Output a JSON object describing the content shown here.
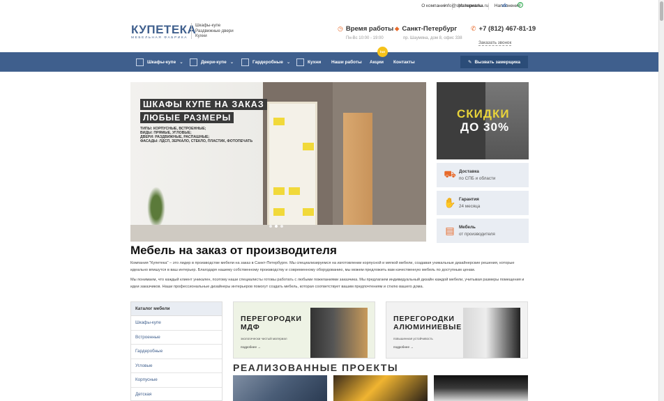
{
  "topbar": {
    "links": [
      "О компании",
      "Материалы",
      "Наполнение"
    ],
    "email": "info@spb.kupeteka.ru",
    "social": [
      "vk-icon",
      "whatsapp-icon"
    ]
  },
  "header": {
    "logo": {
      "brand": "КУПЕТЕКА",
      "tagline": "МЕБЕЛЬНАЯ ФАБРИКА"
    },
    "tags": [
      "Шкафы-купе",
      "Раздвижные двери",
      "Кухни"
    ],
    "hours": {
      "title": "Время работы",
      "desc": "Пн-Вс 10:00 - 19:00"
    },
    "city": {
      "title": "Санкт-Петербург",
      "desc": "пр. Шаумяна, дом 8, офис 338"
    },
    "phone": {
      "title": "+7 (812) 467-81-19",
      "callback": "Заказать звонок"
    }
  },
  "nav": {
    "items": [
      {
        "label": "Шкафы-купе",
        "dropdown": true
      },
      {
        "label": "Двери-купе",
        "dropdown": true
      },
      {
        "label": "Гардеробные",
        "dropdown": true
      },
      {
        "label": "Кухни",
        "dropdown": false
      },
      {
        "label": "Наши работы",
        "dropdown": false
      },
      {
        "label": "Акции",
        "dropdown": false
      },
      {
        "label": "Контакты",
        "dropdown": false
      }
    ],
    "badge": "hot",
    "cta": "Вызвать замерщика"
  },
  "hero": {
    "line1": "ШКАФЫ КУПЕ НА ЗАКАЗ",
    "line2": "ЛЮБЫЕ РАЗМЕРЫ",
    "details": [
      "ТИПЫ: КОРПУСНЫЕ, ВСТРОЕННЫЕ;",
      "ВИДЫ: ПРЯМЫЕ, УГЛОВЫЕ;",
      "ДВЕРИ: РАЗДВИЖНЫЕ, РАСПАШНЫЕ;",
      "ФАСАДЫ: ЛДСП, ЗЕРКАЛО, СТЕКЛО, ПЛАСТИК, ФОТОПЕЧАТЬ"
    ]
  },
  "promo": {
    "line1": "СКИДКИ",
    "line2": "ДО 30%"
  },
  "features": [
    {
      "icon": "delivery-icon",
      "title": "Доставка",
      "desc": "по СПБ и области"
    },
    {
      "icon": "guarantee-icon",
      "title": "Гарантия",
      "desc": "24 месяца"
    },
    {
      "icon": "furniture-icon",
      "title": "Мебель",
      "desc": "от производителя"
    }
  ],
  "intro": {
    "title": "Мебель на заказ от производителя",
    "p1": "Компания \"Купетека\" – это лидер в производстве мебели на заказ в Санкт-Петербурге. Мы специализируемся на изготовлении корпусной и мягкой мебели, создавая уникальные дизайнерские решения, которые идеально впишутся в ваш интерьер. Благодаря нашему собственному производству и современному оборудованию, мы можем предложить вам качественную мебель по доступным ценам.",
    "p2": "Мы понимаем, что каждый клиент уникален, поэтому наши специалисты готовы работать с любыми пожеланиями заказчика. Мы предлагаем индивидуальный дизайн каждой мебели, учитывая размеры помещения и идеи заказчиков. Наши профессиональные дизайнеры интерьеров помогут создать мебель, которая соответствует вашим предпочтениям и стилю вашего дома."
  },
  "catalog": {
    "title": "Каталог мебели",
    "items": [
      "Шкафы-купе",
      "Встроенные",
      "Гардеробные",
      "Угловые",
      "Корпусные",
      "Детская"
    ]
  },
  "banners": [
    {
      "title": "ПЕРЕГОРОДКИ МДФ",
      "subtitle": "экологически чистый материал",
      "more": "подробнее →"
    },
    {
      "title": "ПЕРЕГОРОДКИ АЛЮМИНИЕВЫЕ",
      "subtitle": "повышенная устойчивость",
      "more": "подробнее →"
    }
  ],
  "projects": {
    "title": "РЕАЛИЗОВАННЫЕ ПРОЕКТЫ"
  },
  "colors": {
    "brand": "#3f5f8d",
    "accent": "#e86a2a",
    "badge": "#f5c21b"
  }
}
